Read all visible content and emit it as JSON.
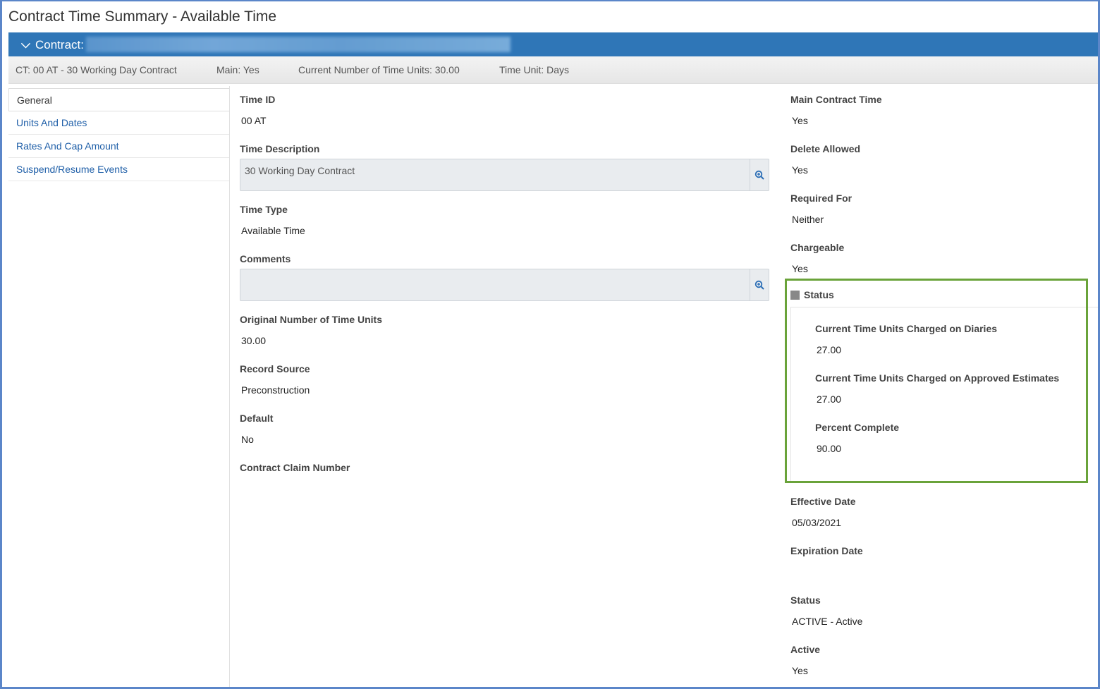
{
  "page": {
    "title": "Contract Time Summary - Available Time"
  },
  "contract_bar": {
    "label": "Contract:"
  },
  "info_strip": {
    "ct": "CT: 00 AT - 30 Working Day Contract",
    "main": "Main: Yes",
    "current_units": "Current Number of Time Units: 30.00",
    "time_unit": "Time Unit: Days"
  },
  "sidebar": {
    "items": [
      {
        "label": "General"
      },
      {
        "label": "Units And Dates"
      },
      {
        "label": "Rates And Cap Amount"
      },
      {
        "label": "Suspend/Resume Events"
      }
    ]
  },
  "left_fields": {
    "time_id": {
      "label": "Time ID",
      "value": "00 AT"
    },
    "time_description": {
      "label": "Time Description",
      "value": "30 Working Day Contract"
    },
    "time_type": {
      "label": "Time Type",
      "value": "Available Time"
    },
    "comments": {
      "label": "Comments",
      "value": ""
    },
    "original_units": {
      "label": "Original Number of Time Units",
      "value": "30.00"
    },
    "record_source": {
      "label": "Record Source",
      "value": "Preconstruction"
    },
    "default": {
      "label": "Default",
      "value": "No"
    },
    "claim_number": {
      "label": "Contract Claim Number",
      "value": ""
    }
  },
  "right_fields": {
    "main_contract_time": {
      "label": "Main Contract Time",
      "value": "Yes"
    },
    "delete_allowed": {
      "label": "Delete Allowed",
      "value": "Yes"
    },
    "required_for": {
      "label": "Required For",
      "value": "Neither"
    },
    "chargeable": {
      "label": "Chargeable",
      "value": "Yes"
    },
    "effective_date": {
      "label": "Effective Date",
      "value": "05/03/2021"
    },
    "expiration_date": {
      "label": "Expiration Date",
      "value": ""
    },
    "status": {
      "label": "Status",
      "value": "ACTIVE - Active"
    },
    "active": {
      "label": "Active",
      "value": "Yes"
    }
  },
  "status_section": {
    "title": "Status",
    "diaries": {
      "label": "Current Time Units Charged on Diaries",
      "value": "27.00"
    },
    "estimates": {
      "label": "Current Time Units Charged on Approved Estimates",
      "value": "27.00"
    },
    "percent": {
      "label": "Percent Complete",
      "value": "90.00"
    }
  },
  "icons": {
    "zoom": "zoom-in-icon",
    "collapse": "chevron-down-icon"
  },
  "colors": {
    "accent": "#2f76b7",
    "highlight": "#6aa33a",
    "link": "#1f5fa8"
  }
}
